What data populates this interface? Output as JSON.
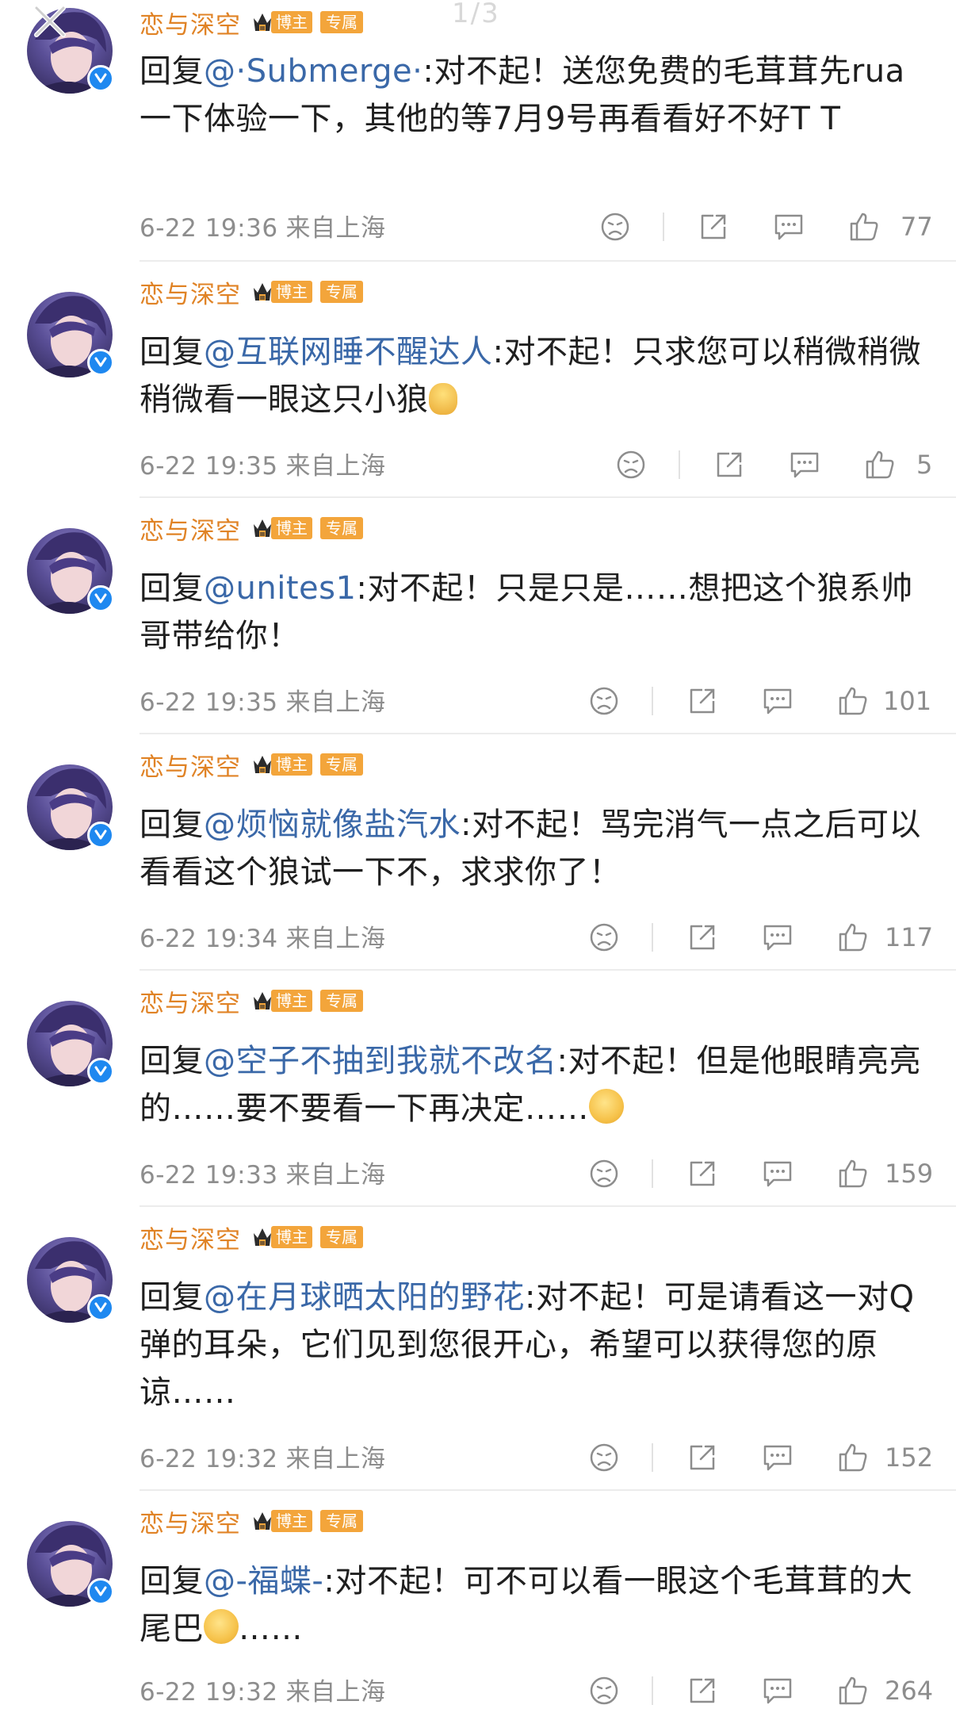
{
  "page_ghost_text": "1/3",
  "author": {
    "name": "恋与深空",
    "badge": "博主",
    "tag": "专属"
  },
  "comments": [
    {
      "prefix": "回复",
      "mention": "@·Submerge·",
      "body": ":对不起！送您免费的毛茸茸先rua一下体验一下，其他的等7月9号再看看好不好T T",
      "time": "6-22 19:36",
      "location": "来自上海",
      "likes": "77"
    },
    {
      "prefix": "回复",
      "mention": "@互联网睡不醒达人",
      "body": ":对不起！只求您可以稍微稍微稍微看一眼这只小狼",
      "emoji": "praying-emoji",
      "time": "6-22 19:35",
      "location": "来自上海",
      "likes": "5"
    },
    {
      "prefix": "回复",
      "mention": "@unites1",
      "body": ":对不起！只是只是……想把这个狼系帅哥带给你！",
      "time": "6-22 19:35",
      "location": "来自上海",
      "likes": "101"
    },
    {
      "prefix": "回复",
      "mention": "@烦恼就像盐汽水",
      "body": ":对不起！骂完消气一点之后可以看看这个狼试一下不，求求你了！",
      "time": "6-22 19:34",
      "location": "来自上海",
      "likes": "117"
    },
    {
      "prefix": "回复",
      "mention": "@空子不抽到我就不改名",
      "body": ":对不起！但是他眼睛亮亮的……要不要看一下再决定……",
      "emoji": "pleading-emoji",
      "time": "6-22 19:33",
      "location": "来自上海",
      "likes": "159"
    },
    {
      "prefix": "回复",
      "mention": "@在月球晒太阳的野花",
      "body": ":对不起！可是请看这一对Q弹的耳朵，它们见到您很开心，希望可以获得您的原谅……",
      "time": "6-22 19:32",
      "location": "来自上海",
      "likes": "152"
    },
    {
      "prefix": "回复",
      "mention": "@-福蝶-",
      "body_before": ":对不起！可不可以看一眼这个毛茸茸的大尾巴",
      "emoji": "pleading-emoji",
      "body_after": "……",
      "time": "6-22 19:32",
      "location": "来自上海",
      "likes": "264"
    }
  ],
  "colors": {
    "author_name": "#e08326",
    "mention": "#3a68a8",
    "badge_bg": "#f3a53b",
    "meta_text": "#8d8d8d",
    "verified": "#1e88f0"
  },
  "icons": [
    "close-icon",
    "verified-icon",
    "crown-icon",
    "dislike-icon",
    "share-icon",
    "comment-icon",
    "like-icon"
  ]
}
